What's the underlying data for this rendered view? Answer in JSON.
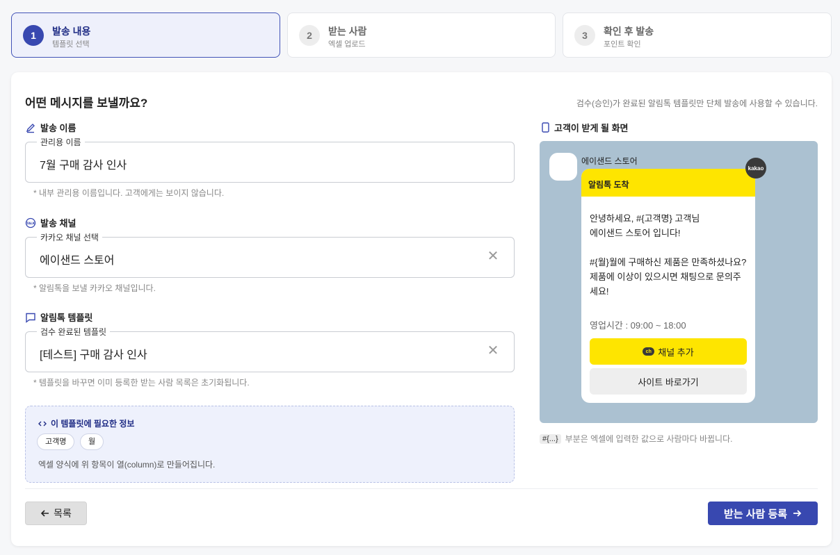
{
  "steps": [
    {
      "num": "1",
      "title": "발송 내용",
      "sub": "템플릿 선택"
    },
    {
      "num": "2",
      "title": "받는 사람",
      "sub": "엑셀 업로드"
    },
    {
      "num": "3",
      "title": "확인 후 발송",
      "sub": "포인트 확인"
    }
  ],
  "page": {
    "heading": "어떤 메시지를 보낼까요?",
    "note": "검수(승인)가 완료된 알림톡 템플릿만 단체 발송에 사용할 수 있습니다."
  },
  "send_name": {
    "label": "발송 이름",
    "legend": "관리용 이름",
    "value": "7월 구매 감사 인사",
    "hint": "* 내부 관리용 이름입니다. 고객에게는 보이지 않습니다."
  },
  "channel": {
    "label": "발송 채널",
    "legend": "카카오 채널 선택",
    "value": "에이샌드 스토어",
    "hint": "* 알림톡을 보낼 카카오 채널입니다."
  },
  "template": {
    "label": "알림톡 템플릿",
    "legend": "검수 완료된 템플릿",
    "value": "[테스트] 구매 감사 인사",
    "hint": "* 템플릿을 바꾸면 이미 등록한 받는 사람 목록은 초기화됩니다."
  },
  "info": {
    "title": "이 템플릿에 필요한 정보",
    "chips": [
      "고객명",
      "월"
    ],
    "desc": "엑셀 양식에 위 항목이 열(column)로 만들어집니다."
  },
  "preview": {
    "label": "고객이 받게 될 화면",
    "sender": "에이샌드 스토어",
    "head": "알림톡 도착",
    "badge": "kakao",
    "body": "안녕하세요, #{고객명} 고객님\n에이샌드 스토어 입니다!\n\n#{월}월에 구매하신 제품은 만족하셨나요?\n제품에 이상이 있으시면 채팅으로 문의주세요!",
    "hours": "영업시간 : 09:00 ~ 18:00",
    "btn_channel": "채널 추가",
    "ch_icon": "ch",
    "btn_site": "사이트 바로가기",
    "note_code": "#{...}",
    "note": "부분은 엑셀에 입력한 값으로 사람마다 바뀝니다."
  },
  "actions": {
    "back": "목록",
    "next": "받는 사람 등록"
  },
  "icons": [
    "pencil-icon",
    "chat-channel-icon",
    "message-icon",
    "code-icon",
    "phone-icon",
    "close-icon",
    "arrow-left-icon",
    "arrow-right-icon"
  ],
  "colors": {
    "accent": "#3848b0",
    "kakao_yellow": "#fee500",
    "preview_bg": "#abc1d1"
  }
}
